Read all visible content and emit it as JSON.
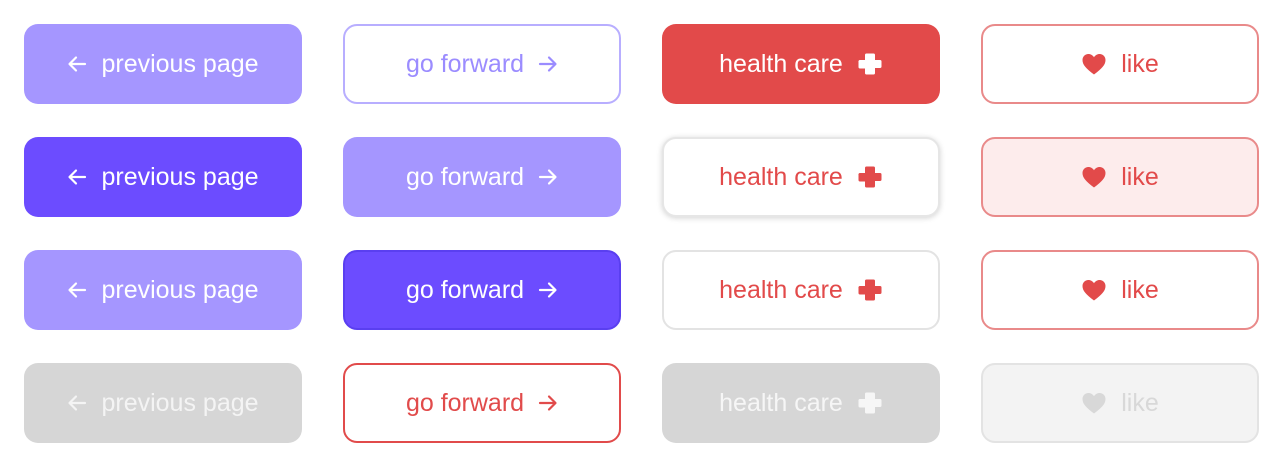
{
  "buttons": {
    "previous_page": {
      "label": "previous page",
      "icon": "arrow-left-icon",
      "states": [
        "default",
        "hover",
        "active",
        "disabled"
      ]
    },
    "go_forward": {
      "label": "go forward",
      "icon": "arrow-right-icon",
      "states": [
        "default",
        "hover",
        "active",
        "error"
      ]
    },
    "health_care": {
      "label": "health care",
      "icon": "plus-cross-icon",
      "states": [
        "default",
        "hover",
        "active",
        "disabled"
      ]
    },
    "like": {
      "label": "like",
      "icon": "heart-icon",
      "states": [
        "default",
        "hover",
        "active",
        "disabled"
      ]
    }
  },
  "colors": {
    "purple_light": "#a596ff",
    "purple_dark": "#6c4cff",
    "red": "#e24a4a",
    "disabled_gray": "#d6d6d6",
    "like_hover_bg": "#fdecec"
  }
}
